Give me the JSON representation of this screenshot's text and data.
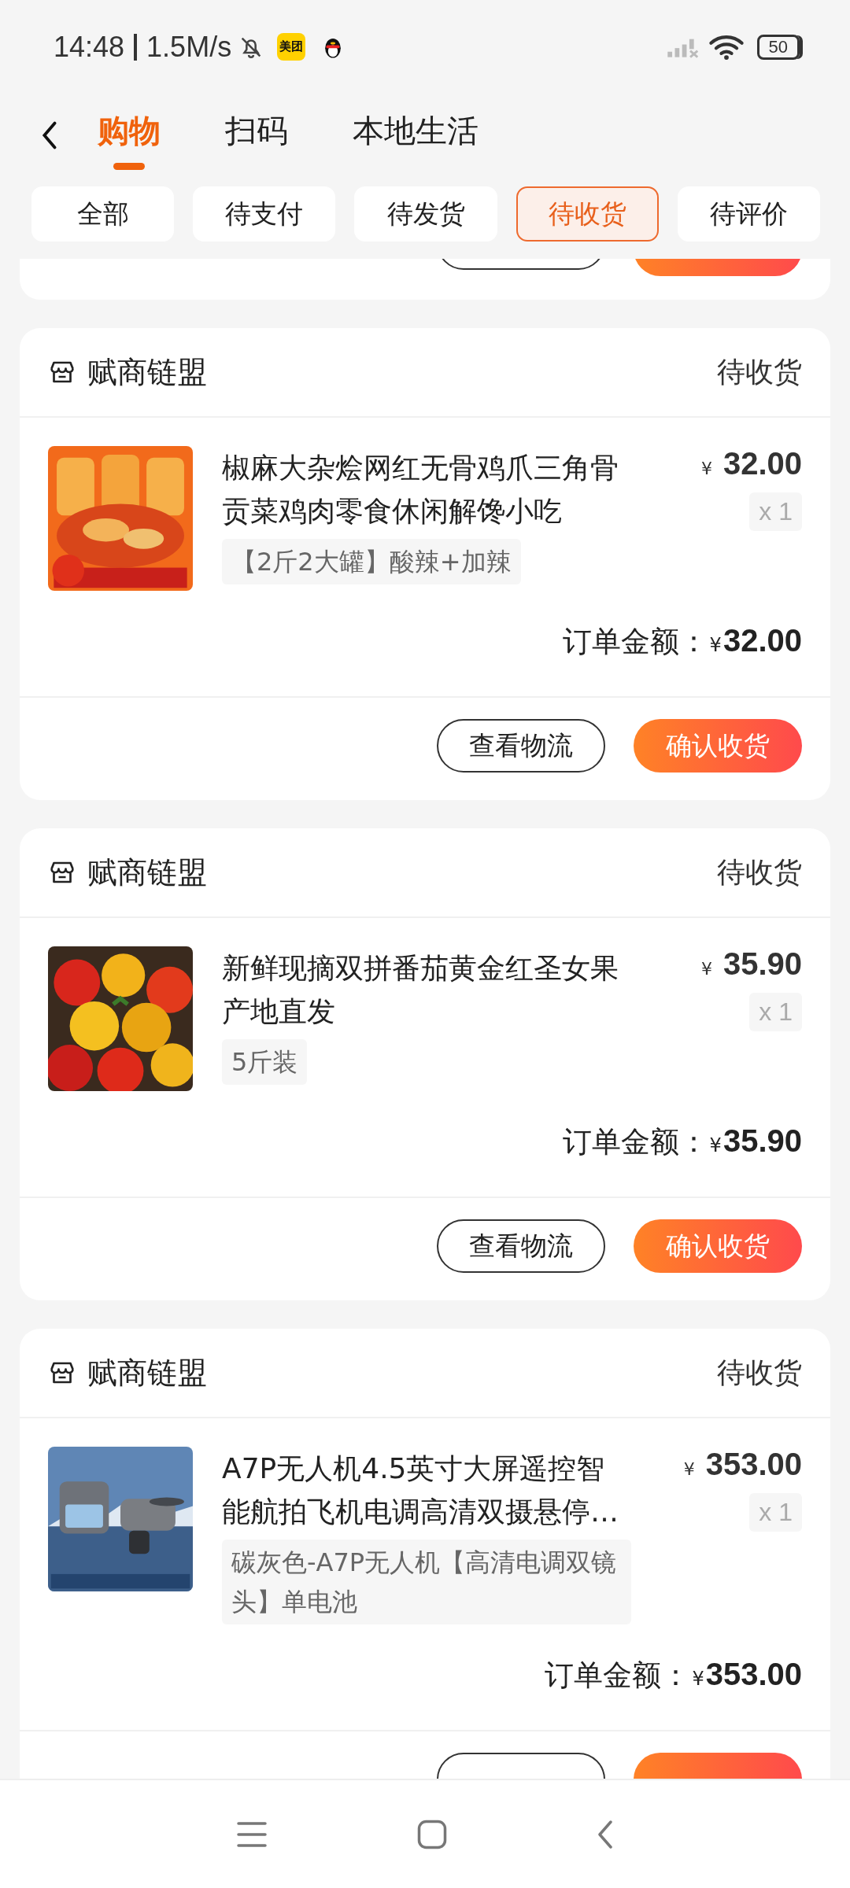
{
  "status_bar": {
    "time": "14:48",
    "speed": "1.5M/s",
    "app_badge": "美团",
    "battery": "50"
  },
  "header": {
    "tabs": [
      {
        "label": "购物",
        "selected": true
      },
      {
        "label": "扫码",
        "selected": false
      },
      {
        "label": "本地生活",
        "selected": false
      }
    ]
  },
  "filters": [
    {
      "label": "全部",
      "selected": false
    },
    {
      "label": "待支付",
      "selected": false
    },
    {
      "label": "待发货",
      "selected": false
    },
    {
      "label": "待收货",
      "selected": true
    },
    {
      "label": "待评价",
      "selected": false
    }
  ],
  "orders": [
    {
      "shop": "赋商链盟",
      "status": "待收货",
      "item": {
        "kind": "picture",
        "title": "椒麻大杂烩网红无骨鸡爪三角骨贡菜鸡肉零食休闲解馋小吃",
        "variant": "【2斤2大罐】酸辣+加辣",
        "currency": "¥",
        "price": "32.00",
        "quantity": "x 1"
      },
      "total_label": "订单金额：",
      "currency": "¥",
      "total": "32.00",
      "buttons": [
        {
          "label": "查看物流",
          "kind": "outline"
        },
        {
          "label": "确认收货",
          "kind": "primary"
        }
      ]
    },
    {
      "shop": "赋商链盟",
      "status": "待收货",
      "item": {
        "kind": "picture",
        "title": "新鲜现摘双拼番茄黄金红圣女果产地直发",
        "variant": "5斤装",
        "currency": "¥",
        "price": "35.90",
        "quantity": "x 1"
      },
      "total_label": "订单金额：",
      "currency": "¥",
      "total": "35.90",
      "buttons": [
        {
          "label": "查看物流",
          "kind": "outline"
        },
        {
          "label": "确认收货",
          "kind": "primary"
        }
      ]
    },
    {
      "shop": "赋商链盟",
      "status": "待收货",
      "item": {
        "kind": "picture",
        "title": "A7P无人机4.5英寸大屏遥控智能航拍飞机电调高清双摄悬停…",
        "variant": "碳灰色-A7P无人机【高清电调双镜头】单电池",
        "currency": "¥",
        "price": "353.00",
        "quantity": "x 1"
      },
      "total_label": "订单金额：",
      "currency": "¥",
      "total": "353.00",
      "buttons": [
        {
          "kind": "outline"
        },
        {
          "kind": "primary"
        }
      ]
    }
  ]
}
